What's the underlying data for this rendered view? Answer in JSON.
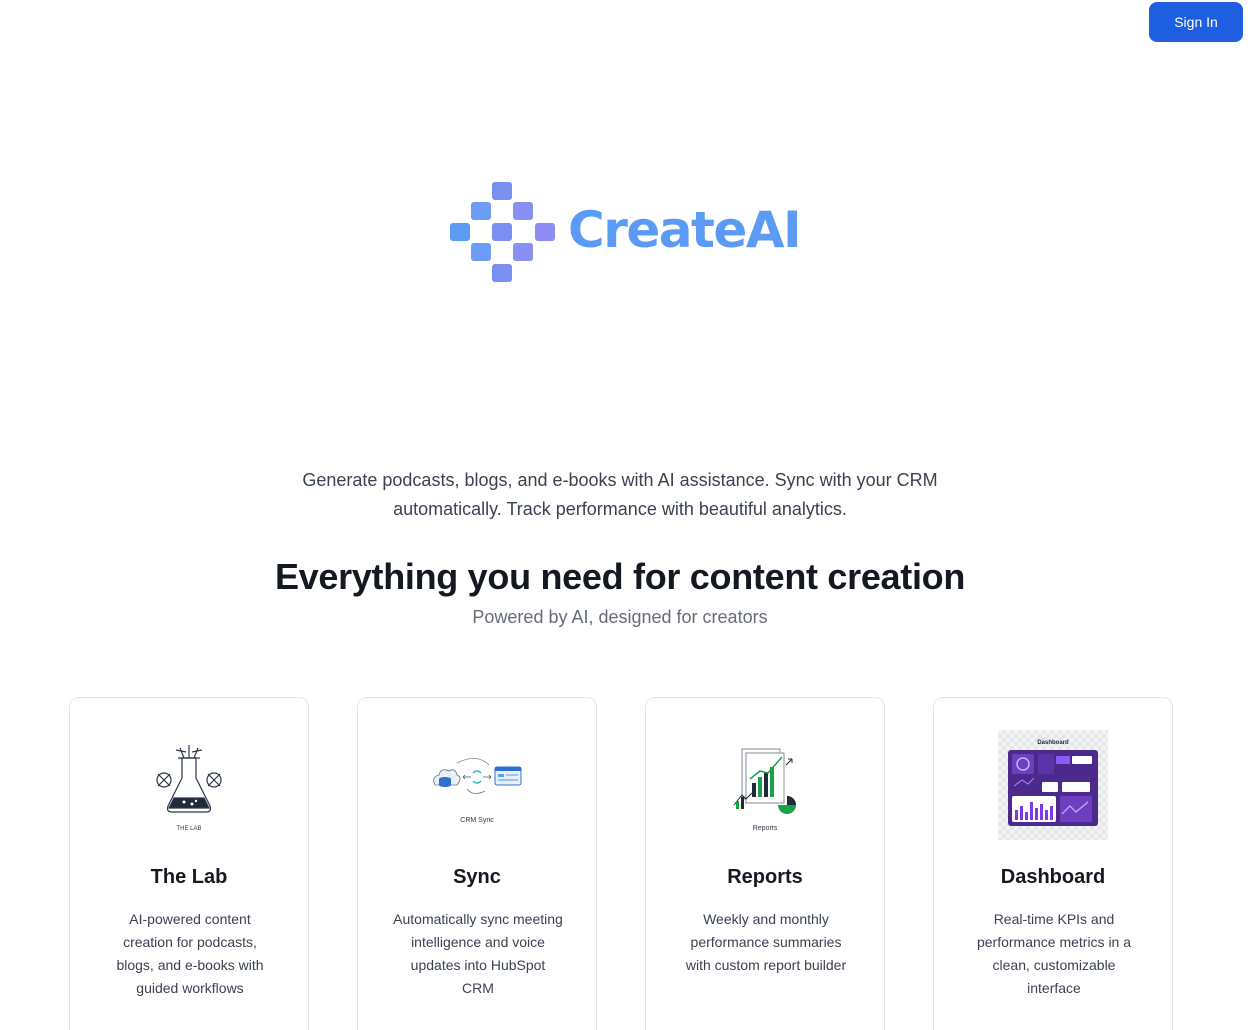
{
  "header": {
    "signin_label": "Sign In"
  },
  "brand": {
    "name": "CreateAI",
    "color": "#5b9bf5",
    "icon": "pixel-cross-logo-icon"
  },
  "hero": {
    "description": "Generate podcasts, blogs, and e-books with AI assistance. Sync with your CRM automatically. Track performance with beautiful analytics."
  },
  "features": {
    "title": "Everything you need for content creation",
    "subtitle": "Powered by AI, designed for creators",
    "cards": [
      {
        "title": "The Lab",
        "description": "AI-powered content creation for podcasts, blogs, and e-books with guided workflows",
        "icon": "lab-flask-icon",
        "caption": "THE LAB"
      },
      {
        "title": "Sync",
        "description": "Automatically sync meeting intelligence and voice updates into HubSpot CRM",
        "icon": "crm-sync-icon",
        "caption": "CRM Sync"
      },
      {
        "title": "Reports",
        "description": "Weekly and monthly performance summaries with custom report builder",
        "icon": "reports-chart-icon",
        "caption": "Reports"
      },
      {
        "title": "Dashboard",
        "description": "Real-time KPIs and performance metrics in a clean, customizable interface",
        "icon": "dashboard-icon",
        "caption": "Dashboard"
      }
    ]
  },
  "colors": {
    "primary_button": "#1d5fe0",
    "heading": "#141821"
  }
}
